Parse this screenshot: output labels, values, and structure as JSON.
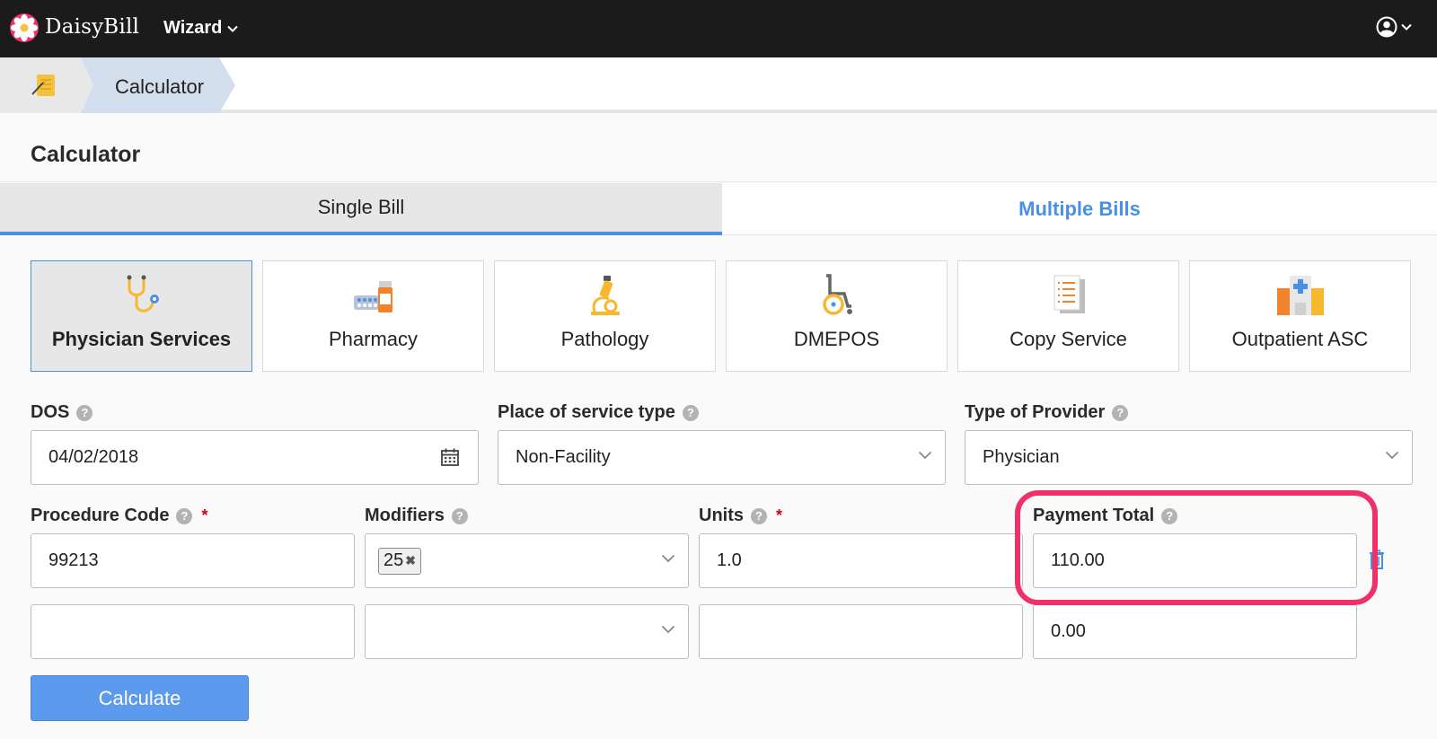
{
  "app": {
    "brand": "DaisyBill",
    "menu_label": "Wizard"
  },
  "breadcrumb": {
    "current": "Calculator"
  },
  "page": {
    "title": "Calculator"
  },
  "tabs": [
    {
      "label": "Single Bill",
      "active": true
    },
    {
      "label": "Multiple Bills",
      "active": false
    }
  ],
  "categories": [
    {
      "label": "Physician Services",
      "icon": "stethoscope-icon",
      "active": true
    },
    {
      "label": "Pharmacy",
      "icon": "pharmacy-icon",
      "active": false
    },
    {
      "label": "Pathology",
      "icon": "microscope-icon",
      "active": false
    },
    {
      "label": "DMEPOS",
      "icon": "wheelchair-icon",
      "active": false
    },
    {
      "label": "Copy Service",
      "icon": "document-icon",
      "active": false
    },
    {
      "label": "Outpatient ASC",
      "icon": "hospital-icon",
      "active": false
    }
  ],
  "form": {
    "dos": {
      "label": "DOS",
      "value": "04/02/2018"
    },
    "place_of_service": {
      "label": "Place of service type",
      "value": "Non-Facility"
    },
    "provider_type": {
      "label": "Type of Provider",
      "value": "Physician"
    },
    "procedure_code": {
      "label": "Procedure Code",
      "required": "*"
    },
    "modifiers": {
      "label": "Modifiers"
    },
    "units": {
      "label": "Units",
      "required": "*"
    },
    "payment_total": {
      "label": "Payment Total"
    },
    "rows": [
      {
        "procedure_code": "99213",
        "modifier_tags": [
          "25"
        ],
        "units": "1.0",
        "payment_total": "110.00"
      },
      {
        "procedure_code": "",
        "modifier_tags": [],
        "units": "",
        "payment_total": "0.00"
      }
    ]
  },
  "help_glyph": "?",
  "buttons": {
    "calculate": "Calculate"
  },
  "colors": {
    "accent": "#4a90e2",
    "highlight": "#f0306b",
    "topbar": "#1b1b1b"
  }
}
